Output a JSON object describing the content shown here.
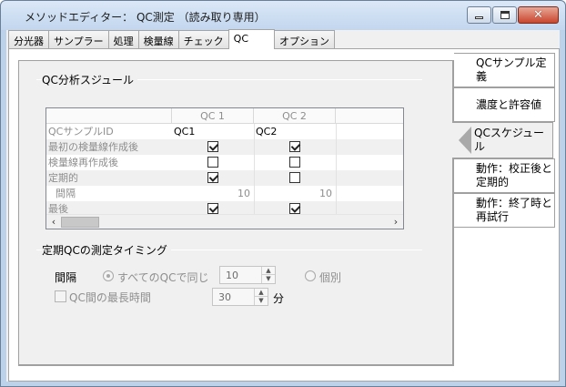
{
  "window": {
    "title": "メソッドエディター： QC測定 （読み取り専用）"
  },
  "tabs": [
    "分光器",
    "サンプラー",
    "処理",
    "検量線",
    "チェック",
    "QC",
    "オプション"
  ],
  "schedule": {
    "group_title": "QC分析スジュール",
    "columns": [
      "QC 1",
      "QC 2"
    ],
    "rows": [
      {
        "label": "QCサンプルID",
        "values": [
          "QC1",
          "QC2"
        ]
      },
      {
        "label": "最初の検量線作成後",
        "checks": [
          true,
          true
        ]
      },
      {
        "label": "検量線再作成後",
        "checks": [
          false,
          false
        ]
      },
      {
        "label": "定期的",
        "checks": [
          true,
          false
        ]
      },
      {
        "label": "間隔",
        "values": [
          "10",
          "10"
        ]
      },
      {
        "label": "最後",
        "checks": [
          true,
          true
        ]
      }
    ]
  },
  "timing": {
    "group_title": "定期QCの測定タイミング",
    "interval_label": "間隔",
    "radio_all_same": "すべてのQCで同じ",
    "interval_value": "10",
    "radio_individual": "個別",
    "max_time_label": "QC間の最長時間",
    "max_time_value": "30",
    "unit": "分"
  },
  "side_tabs": [
    "QCサンプル定義",
    "濃度と許容値",
    "QCスケジュール",
    "動作：校正後と定期的",
    "動作：終了時と再試行"
  ],
  "side_tabs_display": [
    [
      "QCサンプル定義"
    ],
    [
      "濃度と許容値"
    ],
    [
      "QCスケジュール"
    ],
    [
      "動作：校正後と",
      "定期的"
    ],
    [
      "動作：終了時と",
      "再試行"
    ]
  ],
  "colors": {
    "titlebar": "#c2d6ee",
    "close_button": "#c9452d",
    "panel_bg": "#f0f0f0"
  }
}
